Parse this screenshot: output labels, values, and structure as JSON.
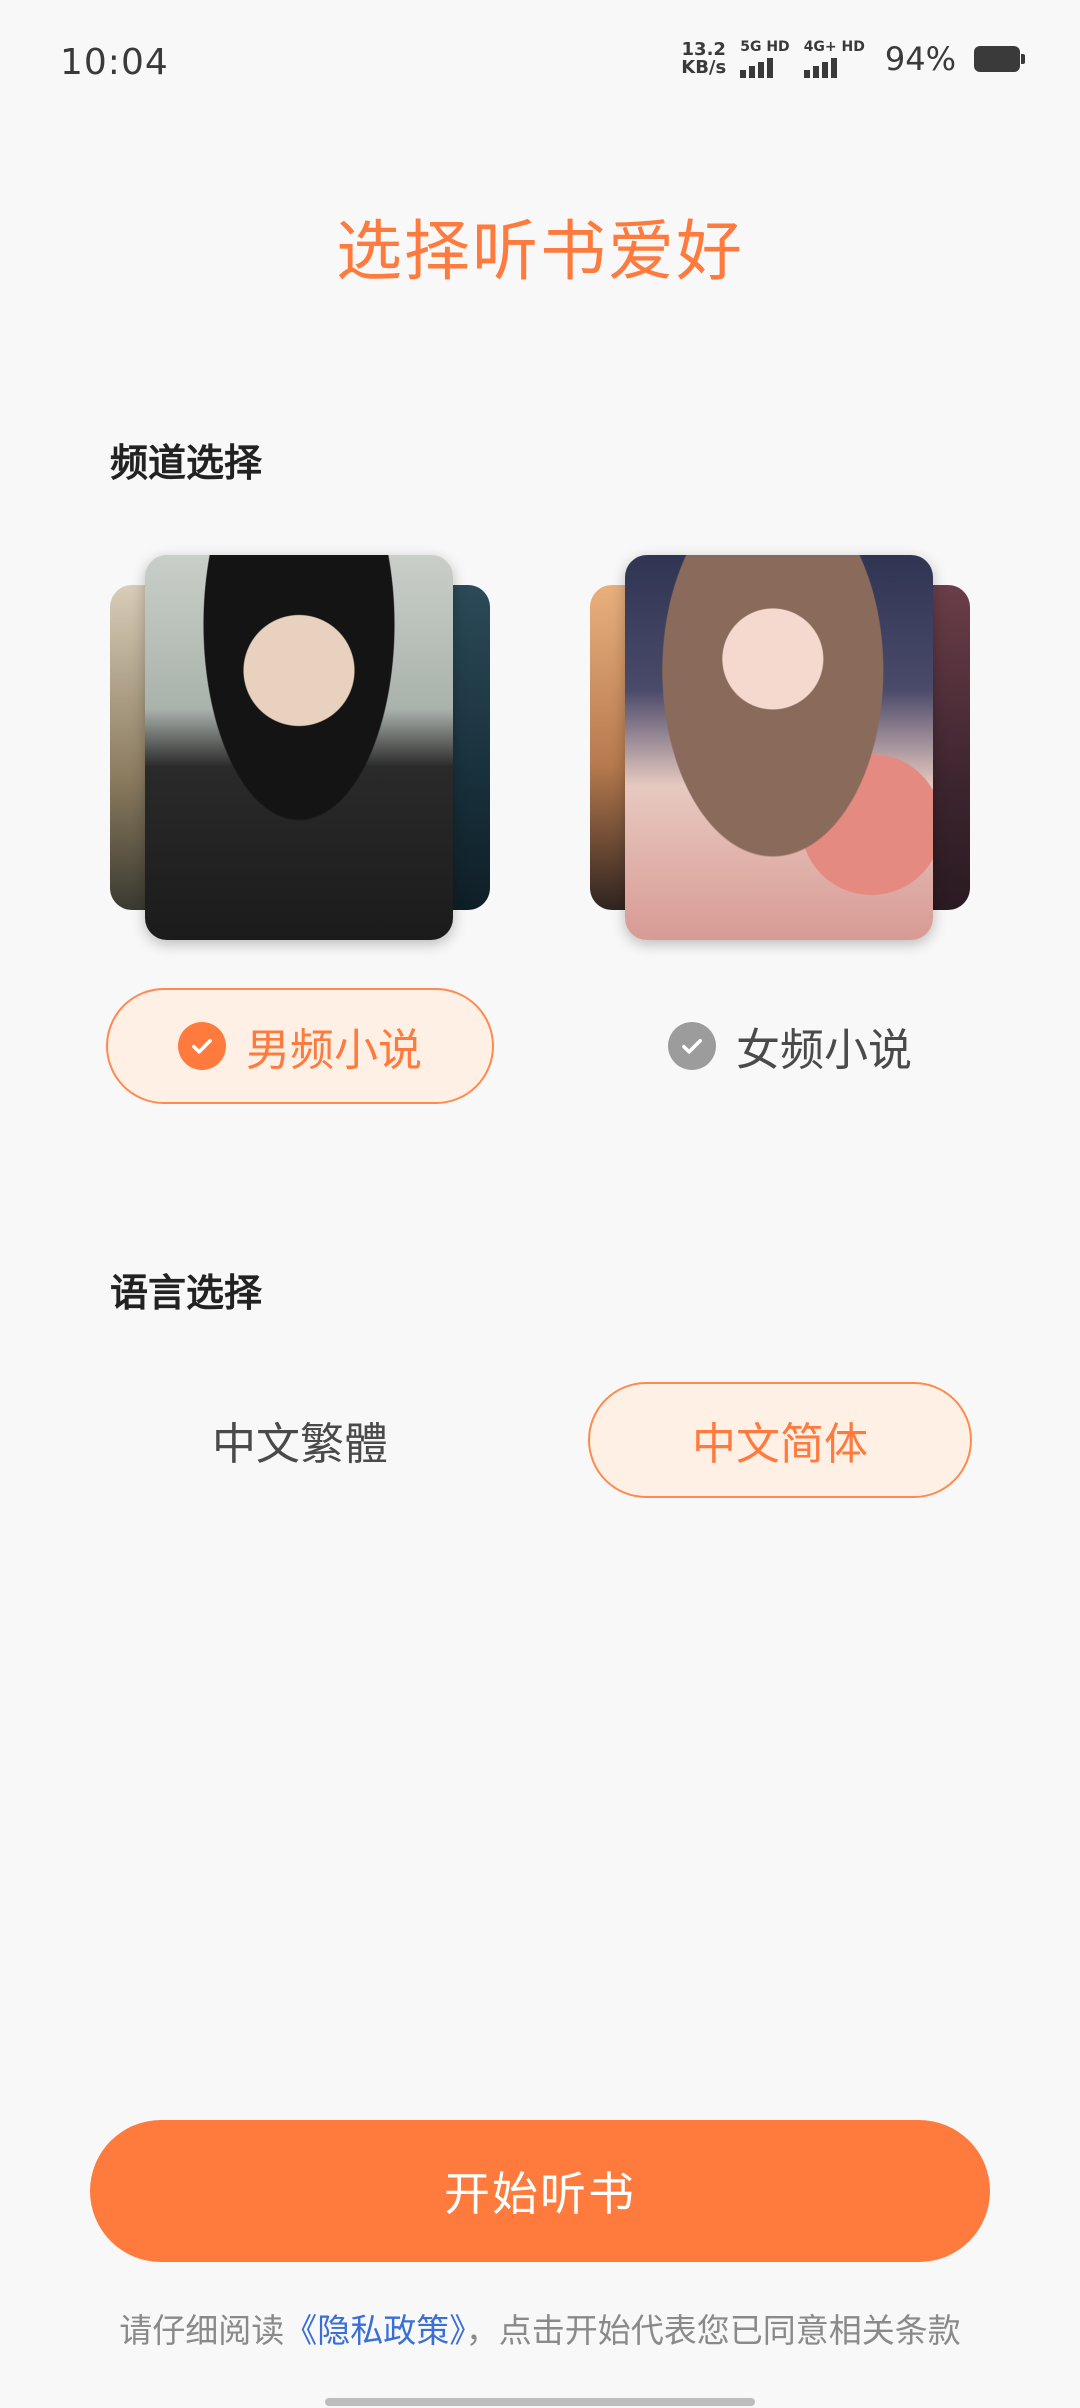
{
  "status_bar": {
    "time": "10:04",
    "net_speed_value": "13.2",
    "net_speed_unit": "KB/s",
    "sim1": "5G HD",
    "sim2": "4G+ HD",
    "battery": "94%"
  },
  "title": "选择听书爱好",
  "channel_section": {
    "label": "频道选择",
    "options": [
      {
        "label": "男频小说",
        "selected": true
      },
      {
        "label": "女频小说",
        "selected": false
      }
    ]
  },
  "language_section": {
    "label": "语言选择",
    "options": [
      {
        "label": "中文繁體",
        "selected": false
      },
      {
        "label": "中文简体",
        "selected": true
      }
    ]
  },
  "start_button": "开始听书",
  "policy": {
    "prefix": "请仔细阅读",
    "link": "《隐私政策》",
    "suffix": "，点击开始代表您已同意相关条款"
  },
  "colors": {
    "accent": "#ff7a3d",
    "selected_bg": "#fff0e6",
    "link": "#3a6fd6"
  }
}
